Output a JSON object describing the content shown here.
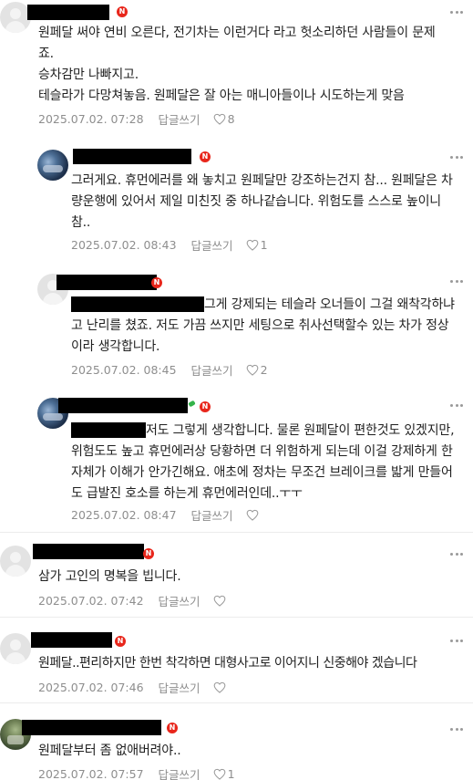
{
  "comments": [
    {
      "body": "원페달 써야 연비 오른다, 전기차는 이런거다 라고 헛소리하던 사람들이 문제죠.\n승차감만 나빠지고.\n테슬라가 다망쳐놓음. 원페달은 잘 아는 매니아들이나 시도하는게 맞음",
      "date": "2025.07.02. 07:28",
      "reply_label": "답글쓰기",
      "likes": "8"
    },
    {
      "body": "그러게요. 휴먼에러를 왜 놓치고 원페달만 강조하는건지 참... 원페달은 차량운행에 있어서 제일 미친짓 중 하나같습니다. 위험도를 스스로 높이니 참..",
      "date": "2025.07.02. 08:43",
      "reply_label": "답글쓰기",
      "likes": "1"
    },
    {
      "body": "그게 강제되는 테슬라 오너들이 그걸 왜착각하냐고 난리를 쳤죠. 저도 가끔 쓰지만 세팅으로 취사선택할수 있는 차가 정상이라 생각합니다.",
      "date": "2025.07.02. 08:45",
      "reply_label": "답글쓰기",
      "likes": "2"
    },
    {
      "body": "저도 그렇게 생각합니다. 물론 원페달이 편한것도 있겠지만, 위험도도 높고 휴먼에러상 당황하면 더 위험하게 되는데 이걸 강제하게 한 자체가 이해가 안가긴해요. 애초에 정차는 무조건 브레이크를 밟게 만들어도 급발진 호소를 하는게 휴먼에러인데..ㅜㅜ",
      "date": "2025.07.02. 08:47",
      "reply_label": "답글쓰기",
      "likes": ""
    },
    {
      "body": "삼가 고인의 명복을 빕니다.",
      "date": "2025.07.02. 07:42",
      "reply_label": "답글쓰기",
      "likes": ""
    },
    {
      "body": "원페달..편리하지만 한번 착각하면 대형사고로 이어지니 신중해야 겠습니다",
      "date": "2025.07.02. 07:46",
      "reply_label": "답글쓰기",
      "likes": ""
    },
    {
      "body": "원페달부터 좀 없애버려야..",
      "date": "2025.07.02. 07:57",
      "reply_label": "답글쓰기",
      "likes": "1"
    }
  ],
  "badge_label": "N",
  "colors": {
    "badge": "#e8261b",
    "meta_text": "#8e8e8e",
    "body_text": "#1f1f1f",
    "divider": "#ececec"
  }
}
